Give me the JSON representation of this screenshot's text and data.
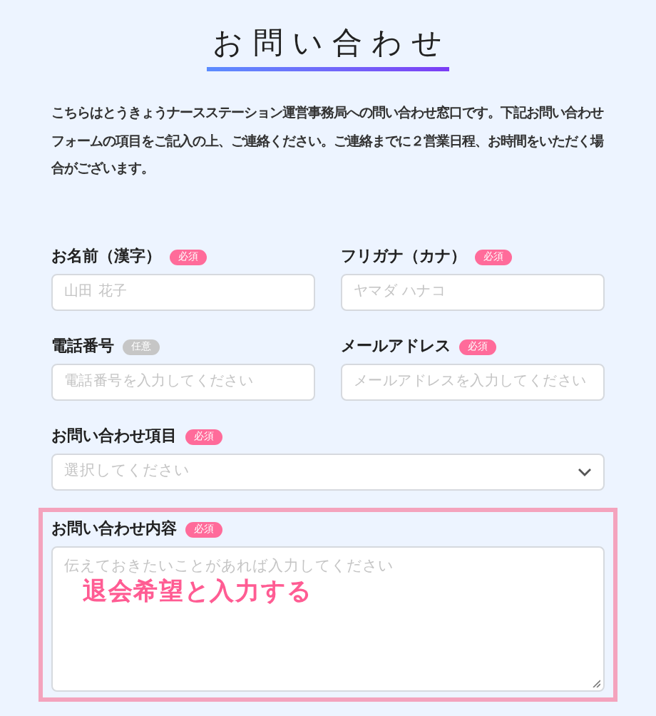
{
  "title": "お問い合わせ",
  "intro": "こちらはとうきょうナースステーション運営事務局への問い合わせ窓口です。下記お問い合わせフォームの項目をご記入の上、ご連絡ください。ご連絡までに２営業日程、お時間をいただく場合がございます。",
  "fields": [
    {
      "kind": "input",
      "label": "お名前（漢字）",
      "badge": "必須",
      "required": true,
      "placeholder": "山田 花子"
    },
    {
      "kind": "input",
      "label": "フリガナ（カナ）",
      "badge": "必須",
      "required": true,
      "placeholder": "ヤマダ ハナコ"
    },
    {
      "kind": "input",
      "label": "電話番号",
      "badge": "任意",
      "required": false,
      "placeholder": "電話番号を入力してください"
    },
    {
      "kind": "input",
      "label": "メールアドレス",
      "badge": "必須",
      "required": true,
      "placeholder": "メールアドレスを入力してください"
    },
    {
      "kind": "select",
      "label": "お問い合わせ項目",
      "badge": "必須",
      "required": true,
      "placeholder": "選択してください"
    },
    {
      "kind": "textarea",
      "label": "お問い合わせ内容",
      "badge": "必須",
      "required": true,
      "placeholder": "伝えておきたいことがあれば入力してください",
      "highlighted": true,
      "annotation": "退会希望と入力する"
    }
  ]
}
